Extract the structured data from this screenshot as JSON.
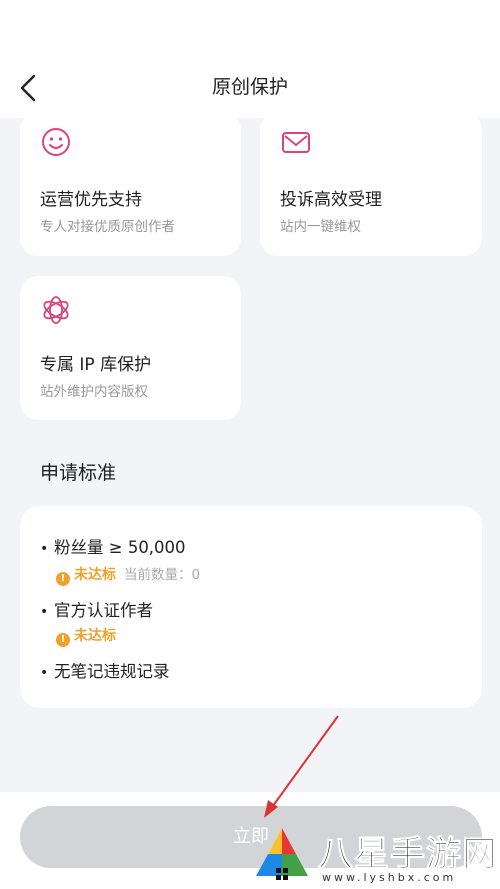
{
  "header": {
    "title": "原创保护"
  },
  "benefits": [
    {
      "title": "运营优先支持",
      "subtitle": "专人对接优质原创作者",
      "icon": "smile-icon"
    },
    {
      "title": "投诉高效受理",
      "subtitle": "站内一键维权",
      "icon": "mail-icon"
    },
    {
      "title": "专属 IP 库保护",
      "subtitle": "站外维护内容版权",
      "icon": "flower-icon"
    }
  ],
  "requirements": {
    "title": "申请标准",
    "items": [
      {
        "text": "粉丝量 ≥ 50,000",
        "status": "未达标",
        "detail": "当前数量：0"
      },
      {
        "text": "官方认证作者",
        "status": "未达标"
      },
      {
        "text": "无笔记违规记录"
      }
    ]
  },
  "footer": {
    "button_label": "立即"
  },
  "watermark": {
    "name": "八星手游网",
    "url": "www.lyshbx.com"
  },
  "colors": {
    "accent": "#d9457c",
    "warning": "#f0a12d",
    "button_disabled": "#d3d4d8"
  }
}
